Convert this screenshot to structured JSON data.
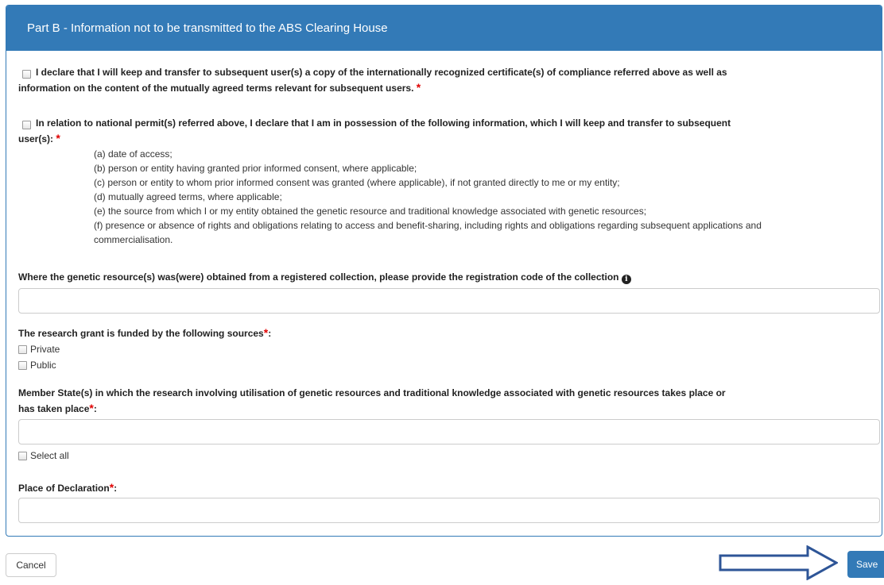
{
  "panel": {
    "title": "Part B - Information not to be transmitted to the ABS Clearing House"
  },
  "declaration1": {
    "line1": "I declare that I will keep and transfer to subsequent user(s) a copy of the internationally recognized certificate(s) of compliance referred above as well as",
    "line2": "information on the content of the mutually agreed terms relevant for subsequent users.",
    "required_mark": "*"
  },
  "declaration2": {
    "line1": "In relation to national permit(s) referred above, I declare that I am in possession of the following information, which I will keep and transfer to subsequent",
    "line2": "user(s):",
    "required_mark": "*",
    "items": [
      "(a) date of access;",
      "(b) person or entity having granted prior informed consent, where applicable;",
      "(c) person or entity to whom prior informed consent was granted (where applicable), if not granted directly to me or my entity;",
      "(d) mutually agreed terms, where applicable;",
      "(e) the source from which I or my entity obtained the genetic resource and traditional knowledge associated with genetic resources;",
      "(f) presence or absence of rights and obligations relating to access and benefit-sharing, including rights and obligations regarding subsequent applications and",
      "commercialisation."
    ]
  },
  "registration": {
    "label": "Where the genetic resource(s) was(were) obtained from a registered collection, please provide the registration code of the collection",
    "info_icon": "info-circle-icon",
    "value": ""
  },
  "funding": {
    "label": "The research grant is funded by the following sources",
    "required_mark": "*",
    "suffix": ":",
    "options": [
      "Private",
      "Public"
    ]
  },
  "member_states": {
    "label_line1": "Member State(s) in which the research involving utilisation of genetic resources and traditional knowledge associated with genetic resources takes place or",
    "label_line2": "has taken place",
    "required_mark": "*",
    "suffix": ":",
    "value": "",
    "select_all_label": "Select all"
  },
  "place": {
    "label": "Place of Declaration",
    "required_mark": "*",
    "suffix": ":",
    "value": ""
  },
  "buttons": {
    "cancel": "Cancel",
    "save": "Save"
  },
  "colors": {
    "primary": "#337ab7",
    "required": "#e00000"
  }
}
